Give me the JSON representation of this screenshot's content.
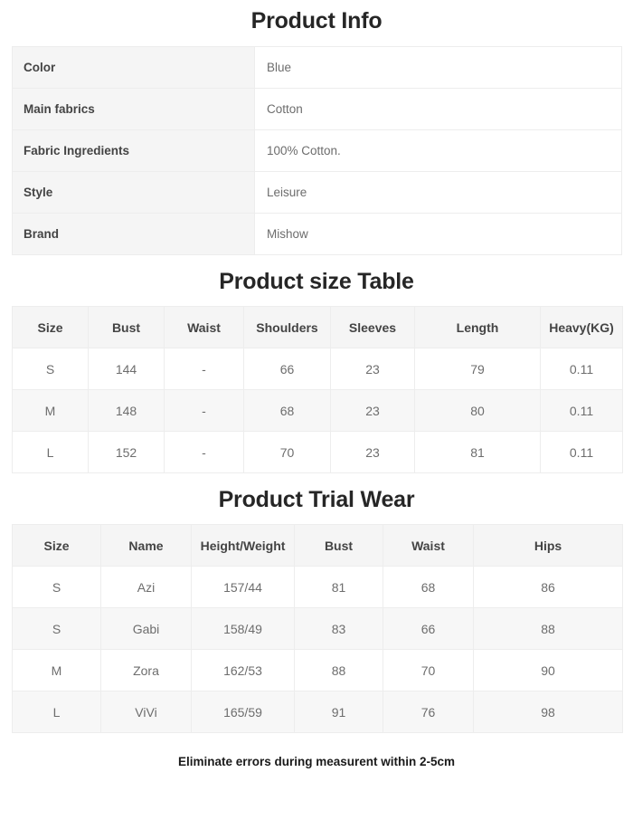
{
  "sections": {
    "product_info": {
      "title": "Product Info",
      "rows": [
        {
          "label": "Color",
          "value": "Blue"
        },
        {
          "label": "Main fabrics",
          "value": "Cotton"
        },
        {
          "label": "Fabric Ingredients",
          "value": "100% Cotton."
        },
        {
          "label": "Style",
          "value": "Leisure"
        },
        {
          "label": "Brand",
          "value": "Mishow"
        }
      ]
    },
    "size_table": {
      "title": "Product size Table",
      "columns": [
        "Size",
        "Bust",
        "Waist",
        "Shoulders",
        "Sleeves",
        "Length",
        "Heavy(KG)"
      ],
      "rows": [
        {
          "size": "S",
          "bust": "144",
          "waist": "-",
          "shoulders": "66",
          "sleeves": "23",
          "length": "79",
          "heavy": "0.11"
        },
        {
          "size": "M",
          "bust": "148",
          "waist": "-",
          "shoulders": "68",
          "sleeves": "23",
          "length": "80",
          "heavy": "0.11"
        },
        {
          "size": "L",
          "bust": "152",
          "waist": "-",
          "shoulders": "70",
          "sleeves": "23",
          "length": "81",
          "heavy": "0.11"
        }
      ]
    },
    "trial_wear": {
      "title": "Product Trial Wear",
      "columns": [
        "Size",
        "Name",
        "Height/Weight",
        "Bust",
        "Waist",
        "Hips"
      ],
      "rows": [
        {
          "size": "S",
          "name": "Azi",
          "height_weight": "157/44",
          "bust": "81",
          "waist": "68",
          "hips": "86"
        },
        {
          "size": "S",
          "name": "Gabi",
          "height_weight": "158/49",
          "bust": "83",
          "waist": "66",
          "hips": "88"
        },
        {
          "size": "M",
          "name": "Zora",
          "height_weight": "162/53",
          "bust": "88",
          "waist": "70",
          "hips": "90"
        },
        {
          "size": "L",
          "name": "ViVi",
          "height_weight": "165/59",
          "bust": "91",
          "waist": "76",
          "hips": "98"
        }
      ]
    }
  },
  "footer": {
    "note": "Eliminate errors during measurent within 2-5cm"
  },
  "colors": {
    "header_cell_bg": "#f5f5f5",
    "alt_row_bg": "#f7f7f7",
    "cell_bg": "#ffffff",
    "border": "#ededed",
    "title_text": "#262626",
    "label_text": "#444444",
    "value_text": "#6d6d6d"
  }
}
